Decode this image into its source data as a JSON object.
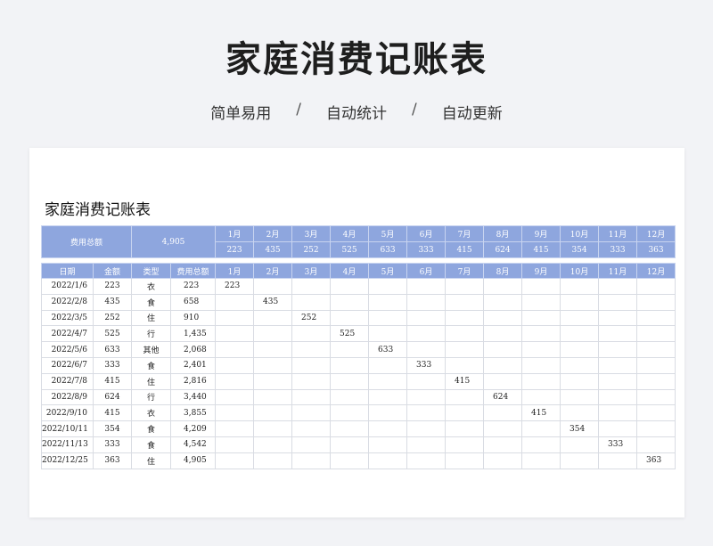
{
  "hero": {
    "title": "家庭消费记账表",
    "subtitle": [
      "简单易用",
      "自动统计",
      "自动更新"
    ],
    "separator": "/"
  },
  "sheet": {
    "title": "家庭消费记账表",
    "summary": {
      "label": "费用总额",
      "total": "4,905",
      "months": [
        "1月",
        "2月",
        "3月",
        "4月",
        "5月",
        "6月",
        "7月",
        "8月",
        "9月",
        "10月",
        "11月",
        "12月"
      ],
      "month_totals": [
        "223",
        "435",
        "252",
        "525",
        "633",
        "333",
        "415",
        "624",
        "415",
        "354",
        "333",
        "363"
      ]
    },
    "columns": [
      "日期",
      "金额",
      "类型",
      "费用总额",
      "1月",
      "2月",
      "3月",
      "4月",
      "5月",
      "6月",
      "7月",
      "8月",
      "9月",
      "10月",
      "11月",
      "12月"
    ],
    "rows": [
      {
        "date": "2022/1/6",
        "amount": "223",
        "type": "衣",
        "cumulative": "223",
        "month": 1
      },
      {
        "date": "2022/2/8",
        "amount": "435",
        "type": "食",
        "cumulative": "658",
        "month": 2
      },
      {
        "date": "2022/3/5",
        "amount": "252",
        "type": "住",
        "cumulative": "910",
        "month": 3
      },
      {
        "date": "2022/4/7",
        "amount": "525",
        "type": "行",
        "cumulative": "1,435",
        "month": 4
      },
      {
        "date": "2022/5/6",
        "amount": "633",
        "type": "其他",
        "cumulative": "2,068",
        "month": 5
      },
      {
        "date": "2022/6/7",
        "amount": "333",
        "type": "食",
        "cumulative": "2,401",
        "month": 6
      },
      {
        "date": "2022/7/8",
        "amount": "415",
        "type": "住",
        "cumulative": "2,816",
        "month": 7
      },
      {
        "date": "2022/8/9",
        "amount": "624",
        "type": "行",
        "cumulative": "3,440",
        "month": 8
      },
      {
        "date": "2022/9/10",
        "amount": "415",
        "type": "衣",
        "cumulative": "3,855",
        "month": 9
      },
      {
        "date": "2022/10/11",
        "amount": "354",
        "type": "食",
        "cumulative": "4,209",
        "month": 10
      },
      {
        "date": "2022/11/13",
        "amount": "333",
        "type": "食",
        "cumulative": "4,542",
        "month": 11
      },
      {
        "date": "2022/12/25",
        "amount": "363",
        "type": "住",
        "cumulative": "4,905",
        "month": 12
      }
    ]
  },
  "colors": {
    "header_fill": "#8ea6de",
    "background": "#f2f3f6"
  }
}
